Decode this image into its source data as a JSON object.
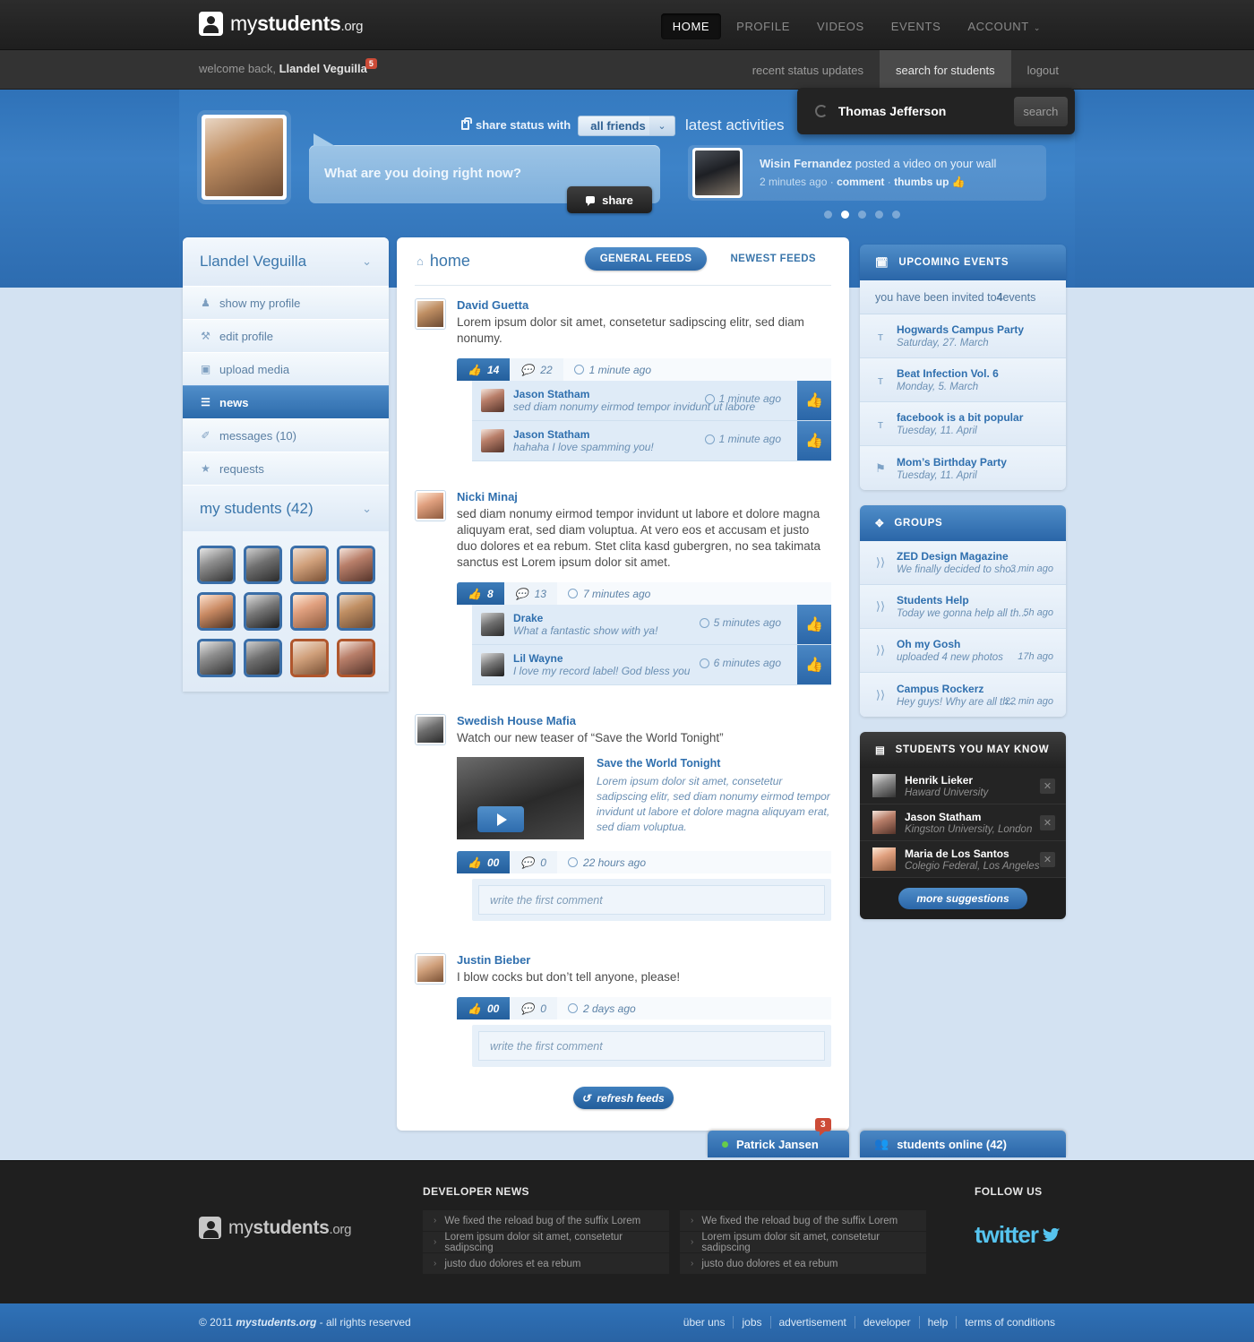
{
  "header": {
    "logo": {
      "pre": "my",
      "mid": "students",
      "suffix": ".org"
    },
    "nav": [
      {
        "label": "HOME",
        "active": true
      },
      {
        "label": "PROFILE",
        "active": false
      },
      {
        "label": "VIDEOS",
        "active": false
      },
      {
        "label": "EVENTS",
        "active": false
      },
      {
        "label": "ACCOUNT",
        "active": false,
        "caret": "⌄"
      }
    ]
  },
  "subbar": {
    "welcome_prefix": "welcome back, ",
    "welcome_name": "Llandel Veguilla",
    "notification_count": "5",
    "links": [
      {
        "label": "recent status updates",
        "active": false
      },
      {
        "label": "search for students",
        "active": true
      },
      {
        "label": "logout",
        "active": false
      }
    ]
  },
  "search": {
    "value": "Thomas Jefferson",
    "placeholder": "Thomas Jefferson",
    "button_label": "search"
  },
  "banner": {
    "share_status_label": "share status with",
    "audience_value": "all friends",
    "audience_caret": "⌄",
    "status_placeholder": "What are you doing right now?",
    "share_button": "share",
    "latest_title": "latest activities",
    "activity": {
      "author": "Wisin Fernandez",
      "action": " posted a video on your wall",
      "time": "2 minutes ago",
      "comment_label": "comment",
      "thumbs_label": "thumbs up"
    },
    "dots": [
      false,
      true,
      false,
      false,
      false
    ]
  },
  "sidebar": {
    "profile_name": "Llandel Veguilla",
    "caret": "⌄",
    "items": [
      {
        "label": "show my profile",
        "icon": "user-icon",
        "glyph": "♟",
        "active": false
      },
      {
        "label": "edit profile",
        "icon": "wrench-icon",
        "glyph": "⚒",
        "active": false
      },
      {
        "label": "upload media",
        "icon": "image-icon",
        "glyph": "▣",
        "active": false
      },
      {
        "label": "news",
        "icon": "document-icon",
        "glyph": "☰",
        "active": true
      },
      {
        "label": "messages (10)",
        "icon": "pencil-icon",
        "glyph": "✐",
        "active": false
      },
      {
        "label": "requests",
        "icon": "star-icon",
        "glyph": "★",
        "active": false
      }
    ],
    "students_title": "my students (42)",
    "students_caret": "⌄",
    "student_avatars": [
      {
        "tone": "p5",
        "warm": false
      },
      {
        "tone": "p2",
        "warm": false
      },
      {
        "tone": "p3",
        "warm": false
      },
      {
        "tone": "p4",
        "warm": false
      },
      {
        "tone": "p7",
        "warm": false
      },
      {
        "tone": "p8",
        "warm": false
      },
      {
        "tone": "p6",
        "warm": false
      },
      {
        "tone": "p1",
        "warm": false
      },
      {
        "tone": "p5",
        "warm": false
      },
      {
        "tone": "p2",
        "warm": false
      },
      {
        "tone": "p3",
        "warm": true
      },
      {
        "tone": "p4",
        "warm": true
      }
    ]
  },
  "feed": {
    "home_label": "home",
    "home_icon": "⌂",
    "tabs": [
      {
        "label": "GENERAL FEEDS",
        "active": true
      },
      {
        "label": "NEWEST FEEDS",
        "active": false
      }
    ],
    "refresh_label": "refresh feeds",
    "refresh_icon": "↺",
    "posts": [
      {
        "author": "David Guetta",
        "avatar_tone": "p1",
        "text": "Lorem ipsum dolor sit amet, consetetur sadipscing elitr, sed diam nonumy.",
        "likes": "14",
        "comments_count": "22",
        "time": "1 minute ago",
        "comments": [
          {
            "author": "Jason Statham",
            "avatar_tone": "p4",
            "text": "sed diam nonumy eirmod tempor invidunt ut labore",
            "time": "1 minute ago"
          },
          {
            "author": "Jason Statham",
            "avatar_tone": "p4",
            "text": "hahaha I love spamming you!",
            "time": "1 minute ago"
          }
        ],
        "comment_placeholder": null,
        "video": null
      },
      {
        "author": "Nicki Minaj",
        "avatar_tone": "p6",
        "text": "sed diam nonumy eirmod tempor invidunt ut labore et dolore magna aliquyam erat, sed diam voluptua. At vero eos et accusam et justo duo dolores et ea rebum. Stet clita kasd gubergren, no sea takimata sanctus est Lorem ipsum dolor sit amet.",
        "likes": "8",
        "comments_count": "13",
        "time": "7 minutes ago",
        "comments": [
          {
            "author": "Drake",
            "avatar_tone": "p2",
            "text": "What a fantastic show with ya!",
            "time": "5 minutes ago"
          },
          {
            "author": "Lil Wayne",
            "avatar_tone": "p8",
            "text": "I love my record label! God bless you",
            "time": "6 minutes ago"
          }
        ],
        "comment_placeholder": null,
        "video": null
      },
      {
        "author": "Swedish House Mafia",
        "avatar_tone": "p2",
        "text": "Watch our new teaser of “Save the World Tonight”",
        "likes": "00",
        "comments_count": "0",
        "time": "22 hours ago",
        "comments": [],
        "comment_placeholder": "write the first comment",
        "video": {
          "title": "Save the World Tonight",
          "description": "Lorem ipsum dolor sit amet, consetetur sadipscing elitr, sed diam nonumy eirmod tempor invidunt ut labore et dolore magna aliquyam erat, sed diam voluptua.",
          "play_icon": "play-icon"
        }
      },
      {
        "author": "Justin Bieber",
        "avatar_tone": "p3",
        "text": "I blow cocks but don’t tell anyone, please!",
        "likes": "00",
        "comments_count": "0",
        "time": "2 days ago",
        "comments": [],
        "comment_placeholder": "write the first comment",
        "video": null
      }
    ]
  },
  "events": {
    "title": "UPCOMING EVENTS",
    "icon": "calendar-icon",
    "note_pre": "you have been invited to ",
    "note_count": "4",
    "note_post": " events",
    "items": [
      {
        "name": "Hogwards Campus Party",
        "date": "Saturday, 27. March",
        "icon": "ᴛ"
      },
      {
        "name": "Beat Infection Vol. 6",
        "date": "Monday, 5. March",
        "icon": "ᴛ"
      },
      {
        "name": "facebook is a bit popular",
        "date": "Tuesday, 11. April",
        "icon": "ᴛ"
      },
      {
        "name": "Mom’s Birthday Party",
        "date": "Tuesday, 11. April",
        "icon": "⚑"
      }
    ]
  },
  "groups": {
    "title": "GROUPS",
    "icon": "compass-icon",
    "items": [
      {
        "name": "ZED Design Magazine",
        "excerpt": "We finally decided to sho...",
        "time": "3 min ago"
      },
      {
        "name": "Students Help",
        "excerpt": "Today we gonna help all th...",
        "time": "5h ago"
      },
      {
        "name": "Oh my Gosh",
        "excerpt": "uploaded 4 new photos",
        "time": "17h ago"
      },
      {
        "name": "Campus Rockerz",
        "excerpt": "Hey guys! Why are all th...",
        "time": "22 min ago"
      }
    ]
  },
  "suggestions": {
    "title": "STUDENTS YOU MAY KNOW",
    "icon": "contacts-icon",
    "items": [
      {
        "name": "Henrik Lieker",
        "school": "Haward University",
        "avatar_tone": "p5",
        "close": "✕"
      },
      {
        "name": "Jason Statham",
        "school": "Kingston University, London",
        "avatar_tone": "p4",
        "close": "✕"
      },
      {
        "name": "Maria de Los Santos",
        "school": "Colegio Federal, Los Angeles",
        "avatar_tone": "p6",
        "close": "✕"
      }
    ],
    "more_label": "more suggestions"
  },
  "chatbar": {
    "friend": {
      "name": "Patrick Jansen",
      "unread": "3"
    },
    "online": {
      "label": "students online (42)",
      "icon": "people-icon"
    }
  },
  "footer": {
    "dev_news_title": "DEVELOPER NEWS",
    "columns": [
      [
        "We fixed the reload bug of the suffix Lorem",
        "Lorem ipsum dolor sit amet, consetetur sadipscing",
        "justo duo dolores et ea rebum"
      ],
      [
        "We fixed the reload bug of the suffix Lorem",
        "Lorem ipsum dolor sit amet, consetetur sadipscing",
        "justo duo dolores et ea rebum"
      ]
    ],
    "follow_title": "FOLLOW US",
    "twitter_label": "twitter"
  },
  "bottom": {
    "copyright_pre": "© 2011 ",
    "copyright_brand": "mystudents.org",
    "copyright_post": " - all rights reserved",
    "links": [
      "über uns",
      "jobs",
      "advertisement",
      "developer",
      "help",
      "terms of conditions"
    ]
  },
  "colors": {
    "accent": "#2f72b8",
    "dark": "#1f1f1f",
    "badge": "#cc4b37",
    "link": "#2f6fae"
  }
}
